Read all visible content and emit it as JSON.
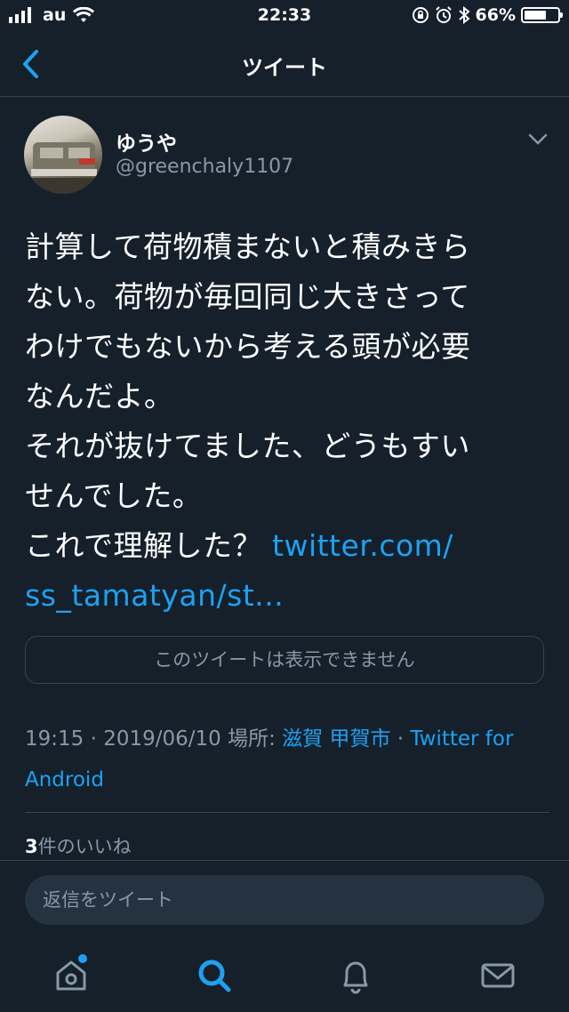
{
  "status_bar": {
    "carrier": "au",
    "time": "22:33",
    "battery_percent": "66%",
    "battery_level": 0.66
  },
  "nav": {
    "title": "ツイート",
    "back_icon": "chevron-left-icon"
  },
  "tweet": {
    "author_name": "ゆうや",
    "author_handle": "@greenchaly1107",
    "text_lines": [
      "計算して荷物積まないと積みきら",
      "ない。荷物が毎回同じ大きさって",
      "わけでもないから考える頭が必要",
      "なんだよ。",
      "それが抜けてました、どうもすい",
      "せんでした。",
      "これで理解した？"
    ],
    "link_part1": "twitter.com/",
    "link_part2": "ss_tamatyan/st...",
    "unavailable_notice": "このツイートは表示できません",
    "timestamp": "19:15 · 2019/06/10",
    "location_label": "場所:",
    "location": "滋賀 甲賀市",
    "source_separator": "·",
    "source_part1": "Twitter for",
    "source_part2": "Android",
    "likes_count": "3",
    "likes_label": "件のいいね"
  },
  "reply": {
    "placeholder": "返信をツイート"
  },
  "tabbar": {
    "icons": [
      "home-icon",
      "search-icon",
      "notifications-icon",
      "messages-icon"
    ],
    "active": "search-icon",
    "accent": "#1da1f2"
  },
  "colors": {
    "background": "#15202b",
    "accent": "#1da1f2",
    "secondary_text": "#8899a6",
    "border": "#38444d"
  }
}
